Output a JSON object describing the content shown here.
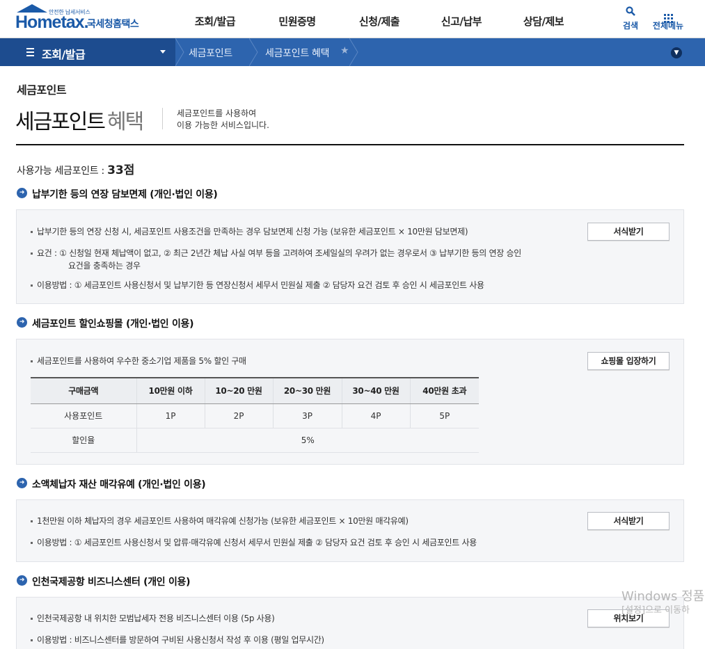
{
  "header": {
    "logo_tag": "안전한 납세서비스",
    "logo_en": "Hometax.",
    "logo_ko": "국세청홈택스",
    "nav": [
      "조회/발급",
      "민원증명",
      "신청/제출",
      "신고/납부",
      "상담/제보"
    ],
    "search_label": "검색",
    "all_menu_label": "전체메뉴"
  },
  "location": {
    "menu_label": "조회/발급",
    "crumbs": [
      "세금포인트",
      "세금포인트 혜택"
    ]
  },
  "page": {
    "path_title": "세금포인트",
    "title_main": "세금포인트",
    "title_sub": "혜택",
    "desc_line1": "세금포인트를 사용하여",
    "desc_line2": "이용 가능한 서비스입니다.",
    "points_label": "사용가능 세금포인트 : ",
    "points_value": "33점"
  },
  "sections": [
    {
      "title": "납부기한 등의 연장 담보면제 (개인·법인 이용)",
      "button": "서식받기",
      "lines": [
        "납부기한 등의 연장 신청 시, 세금포인트 사용조건을 만족하는 경우 담보면제 신청 가능 (보유한 세금포인트 × 10만원 담보면제)",
        "요건 : ① 신청일 현재 체납액이 없고, ② 최근 2년간 체납 사실 여부 등을 고려하여 조세일실의 우려가 없는 경우로서 ③ 납부기한 등의 연장 승인",
        "요건을 충족하는 경우",
        "이용방법 : ① 세금포인트 사용신청서 및 납부기한 등 연장신청서 세무서 민원실 제출 ② 담당자 요건 검토 후 승인 시 세금포인트 사용"
      ]
    },
    {
      "title": "세금포인트 할인쇼핑몰 (개인·법인 이용)",
      "button": "쇼핑몰 입장하기",
      "lines": [
        "세금포인트를 사용하여 우수한 중소기업 제품을 5% 할인 구매"
      ],
      "table": {
        "headers": [
          "구매금액",
          "10만원 이하",
          "10~20 만원",
          "20~30 만원",
          "30~40 만원",
          "40만원 초과"
        ],
        "row1_label": "사용포인트",
        "row1": [
          "1P",
          "2P",
          "3P",
          "4P",
          "5P"
        ],
        "row2_label": "할인율",
        "row2_value": "5%"
      }
    },
    {
      "title": "소액체납자 재산 매각유예 (개인·법인 이용)",
      "button": "서식받기",
      "lines": [
        "1천만원 이하 체납자의 경우 세금포인트 사용하여 매각유예 신청가능 (보유한 세금포인트 × 10만원 매각유예)",
        "이용방법 : ① 세금포인트 사용신청서 및 압류·매각유예 신청서 세무서 민원실 제출 ② 담당자 요건 검토 후 승인 시 세금포인트 사용"
      ]
    },
    {
      "title": "인천국제공항 비즈니스센터 (개인 이용)",
      "button": "위치보기",
      "lines": [
        "인천국제공항 내 위치한 모범납세자 전용 비즈니스센터 이용 (5p 사용)",
        "이용방법 : 비즈니스센터를 방문하여 구비된 사용신청서 작성 후 이용 (평일 업무시간)"
      ]
    }
  ],
  "watermark": {
    "line1": "Windows 정품",
    "line2": "[설정]으로 이동하"
  },
  "colors": {
    "brand": "#1b5aa8",
    "locbar": "#2d64ae",
    "locmenu": "#1d4c8f"
  }
}
